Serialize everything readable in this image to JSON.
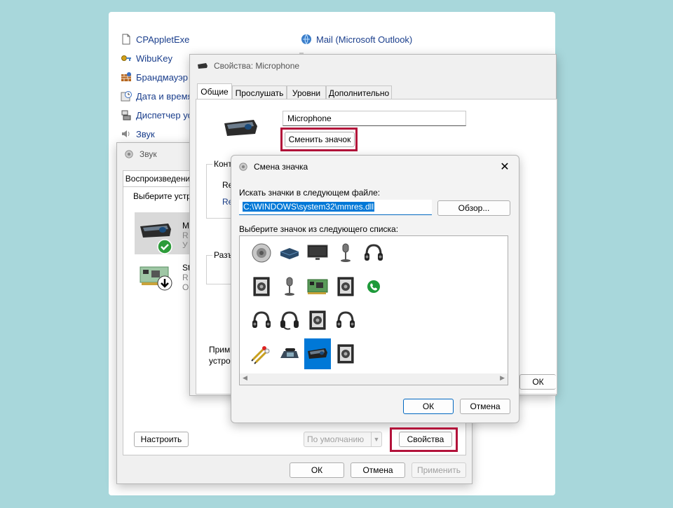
{
  "control_panel": {
    "items": [
      {
        "label": "CPAppletExe",
        "icon": "document-icon"
      },
      {
        "label": "WibuKey",
        "icon": "key-icon"
      },
      {
        "label": "Брандмауэр З",
        "icon": "firewall-icon"
      },
      {
        "label": "Дата и время",
        "icon": "clock-icon"
      },
      {
        "label": "Диспетчер ус",
        "icon": "device-manager-icon"
      },
      {
        "label": "Звук",
        "icon": "speaker-icon"
      }
    ],
    "right_items": [
      {
        "label": "Mail (Microsoft Outlook)",
        "icon": "mail-icon"
      }
    ]
  },
  "sound_dialog": {
    "title": "Звук",
    "tab_playback": "Воспроизведени",
    "instruction": "Выберите устр",
    "device1": {
      "name": "M",
      "line2": "R",
      "line3": "У"
    },
    "device2": {
      "name": "St",
      "line2": "R",
      "line3": "О"
    },
    "configure_button": "Настроить",
    "default_button": "По умолчанию",
    "properties_button": "Свойства",
    "ok_button": "ОК",
    "cancel_button": "Отмена",
    "apply_button": "Применить"
  },
  "props_dialog": {
    "title": "Свойства: Microphone",
    "tabs": [
      "Общие",
      "Прослушать",
      "Уровни",
      "Дополнительно"
    ],
    "name_value": "Microphone",
    "change_icon_button": "Сменить значок",
    "group_controller_prefix": "Конт",
    "r1": "Re",
    "r2": "Re",
    "group_connectors_prefix": "Разъ",
    "apply_prefix1": "Прим",
    "apply_prefix2": "устро",
    "ok_button": "ОК"
  },
  "change_icon_dialog": {
    "title": "Смена значка",
    "search_label": "Искать значки в следующем файле:",
    "file_value": "C:\\WINDOWS\\system32\\mmres.dll",
    "browse_button": "Обзор...",
    "list_label": "Выберите значок из следующего списка:",
    "icons": [
      [
        "speaker-round-icon",
        "receiver-box-icon",
        "monitor-icon",
        "microphone-stand-icon",
        "headphones-icon"
      ],
      [
        "speaker-box-icon",
        "microphone-stand-icon",
        "sound-card-icon",
        "speaker-box-icon",
        "phone-green-icon"
      ],
      [
        "headphones-icon",
        "headset-icon",
        "speaker-box-icon",
        "headphones-icon"
      ],
      [
        "rca-cables-icon",
        "desk-phone-icon",
        "webcam-microphone-icon",
        "speaker-box-icon"
      ]
    ],
    "selected_icon": "webcam-microphone-icon",
    "ok_button": "ОК",
    "cancel_button": "Отмена",
    "close_symbol": "✕",
    "scroll_left": "◀",
    "scroll_right": "▶"
  },
  "colors": {
    "highlight": "#b3123a",
    "selection": "#0078d7",
    "link_blue": "#1a3e8c",
    "background": "#a8d7db"
  }
}
